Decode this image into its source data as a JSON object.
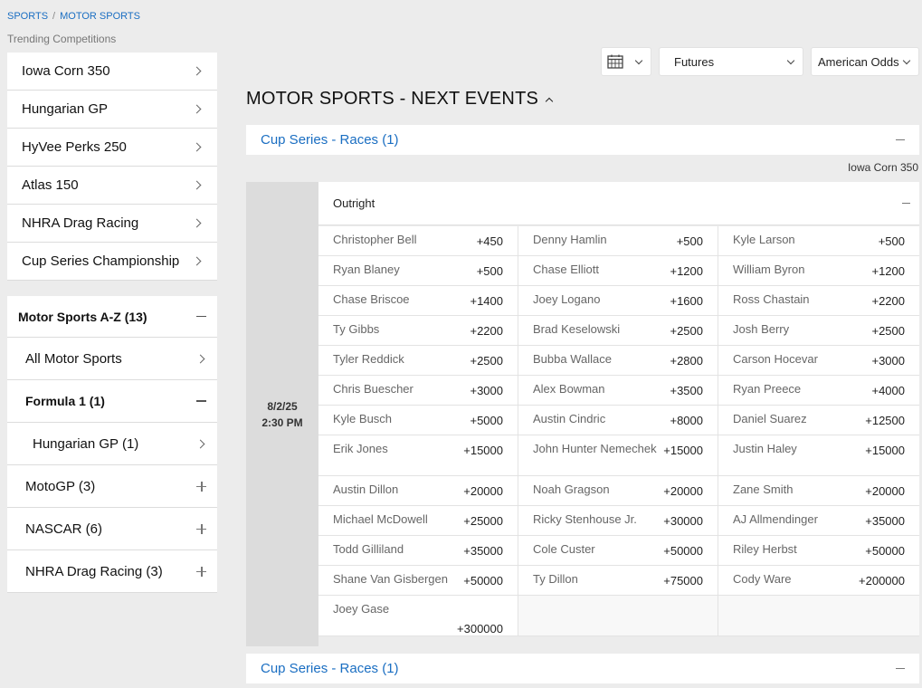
{
  "breadcrumb": {
    "sports": "SPORTS",
    "sep": "/",
    "motor": "MOTOR SPORTS"
  },
  "trending": {
    "label": "Trending Competitions",
    "items": [
      "Iowa Corn 350",
      "Hungarian GP",
      "HyVee Perks 250",
      "Atlas 150",
      "NHRA Drag Racing",
      "Cup Series Championship"
    ]
  },
  "az": {
    "title": "Motor Sports A-Z (13)",
    "all": "All Motor Sports",
    "f1": "Formula 1 (1)",
    "hungarian": "Hungarian GP (1)",
    "motogp": "MotoGP (3)",
    "nascar": "NASCAR (6)",
    "nhra": "NHRA Drag Racing (3)"
  },
  "filters": {
    "market": "Futures",
    "odds_format": "American Odds",
    "calendar_icon": "calendar-icon"
  },
  "section_title": "MOTOR SPORTS - NEXT EVENTS",
  "competition": {
    "label": "Cup Series - Races (1)",
    "label_bottom": "Cup Series - Races (1)"
  },
  "event": {
    "name": "Iowa Corn 350",
    "date": "8/2/25",
    "time": "2:30 PM",
    "market": "Outright"
  },
  "odds": [
    [
      [
        "Christopher Bell",
        "+450"
      ],
      [
        "Denny Hamlin",
        "+500"
      ],
      [
        "Kyle Larson",
        "+500"
      ]
    ],
    [
      [
        "Ryan Blaney",
        "+500"
      ],
      [
        "Chase Elliott",
        "+1200"
      ],
      [
        "William Byron",
        "+1200"
      ]
    ],
    [
      [
        "Chase Briscoe",
        "+1400"
      ],
      [
        "Joey Logano",
        "+1600"
      ],
      [
        "Ross Chastain",
        "+2200"
      ]
    ],
    [
      [
        "Ty Gibbs",
        "+2200"
      ],
      [
        "Brad Keselowski",
        "+2500"
      ],
      [
        "Josh Berry",
        "+2500"
      ]
    ],
    [
      [
        "Tyler Reddick",
        "+2500"
      ],
      [
        "Bubba Wallace",
        "+2800"
      ],
      [
        "Carson Hocevar",
        "+3000"
      ]
    ],
    [
      [
        "Chris Buescher",
        "+3000"
      ],
      [
        "Alex Bowman",
        "+3500"
      ],
      [
        "Ryan Preece",
        "+4000"
      ]
    ],
    [
      [
        "Kyle Busch",
        "+5000"
      ],
      [
        "Austin Cindric",
        "+8000"
      ],
      [
        "Daniel Suarez",
        "+12500"
      ]
    ],
    [
      [
        "Erik Jones",
        "+15000"
      ],
      [
        "John Hunter Nemechek",
        "+15000"
      ],
      [
        "Justin Haley",
        "+15000"
      ]
    ],
    [
      [
        "Austin Dillon",
        "+20000"
      ],
      [
        "Noah Gragson",
        "+20000"
      ],
      [
        "Zane Smith",
        "+20000"
      ]
    ],
    [
      [
        "Michael McDowell",
        "+25000"
      ],
      [
        "Ricky Stenhouse Jr.",
        "+30000"
      ],
      [
        "AJ Allmendinger",
        "+35000"
      ]
    ],
    [
      [
        "Todd Gilliland",
        "+35000"
      ],
      [
        "Cole Custer",
        "+50000"
      ],
      [
        "Riley Herbst",
        "+50000"
      ]
    ],
    [
      [
        "Shane Van Gisbergen",
        "+50000"
      ],
      [
        "Ty Dillon",
        "+75000"
      ],
      [
        "Cody Ware",
        "+200000"
      ]
    ],
    [
      [
        "Joey Gase",
        "+300000"
      ]
    ]
  ]
}
